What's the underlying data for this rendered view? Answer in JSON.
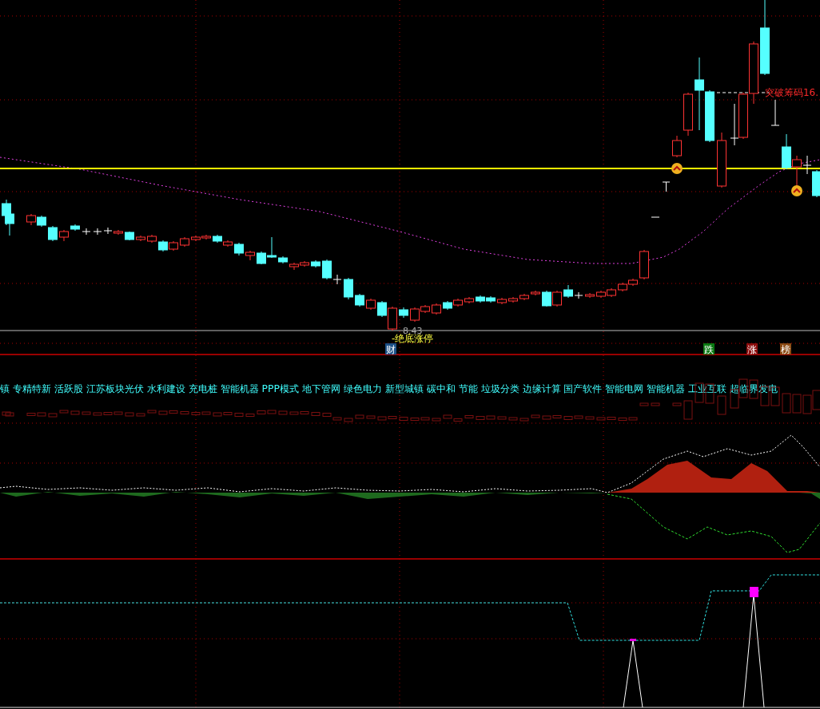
{
  "main_chart": {
    "low_price_label": "8.43",
    "signal_label": "-绝底涨停",
    "breakout_label": "突破筹码16."
  },
  "tags": [
    {
      "text": "财",
      "color": "#1c4f86"
    },
    {
      "text": "跌",
      "color": "#0b7a12"
    },
    {
      "text": "涨",
      "color": "#8c0d0d"
    },
    {
      "text": "榜",
      "color": "#8a4a12"
    }
  ],
  "concepts": "镇 专精特新 活跃股 江苏板块光伏 水利建设 充电桩 智能机器 PPP模式 地下管网 绿色电力 新型城镇 碳中和 节能 垃圾分类 边缘计算 国产软件 智能电网 智能机器 工业互联 超临界发电"
}
